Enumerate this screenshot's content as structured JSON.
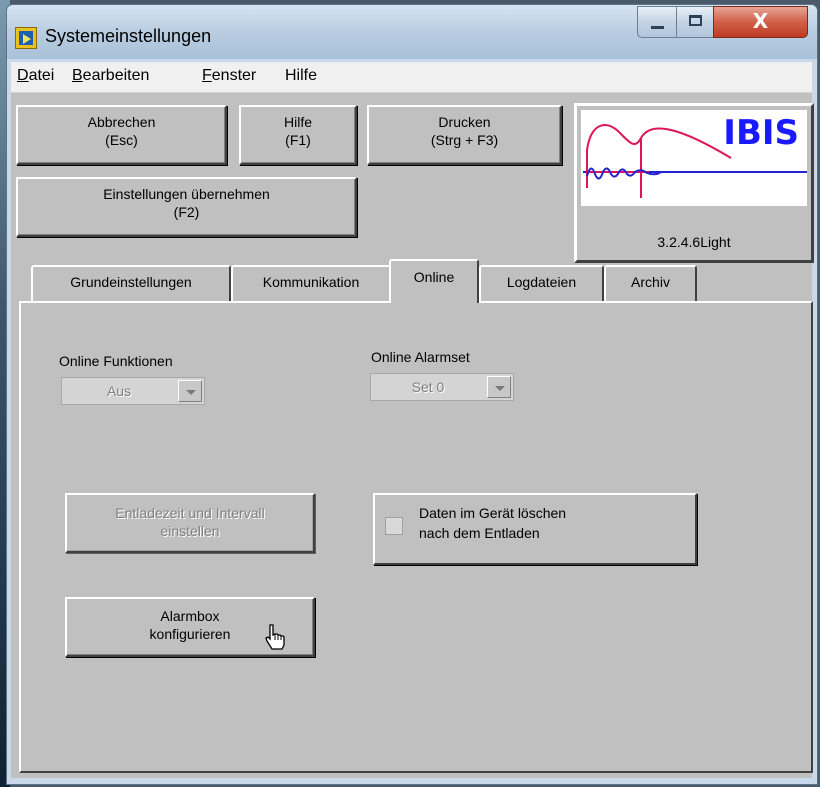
{
  "window": {
    "title": "Systemeinstellungen",
    "close_glyph": "X"
  },
  "menu": [
    {
      "underline": "D",
      "rest": "atei"
    },
    {
      "underline": "B",
      "rest": "earbeiten"
    },
    {
      "underline": "F",
      "rest": "enster"
    },
    {
      "underline": "",
      "rest": "Hilfe"
    }
  ],
  "toolbar": {
    "cancel": {
      "line1": "Abbrechen",
      "line2": "(Esc)"
    },
    "help": {
      "line1": "Hilfe",
      "line2": "(F1)"
    },
    "print": {
      "line1": "Drucken",
      "line2": "(Strg + F3)"
    },
    "apply": {
      "line1": "Einstellungen übernehmen",
      "line2": "(F2)"
    }
  },
  "logo": {
    "text": "IBIS",
    "version": "3.2.4.6Light",
    "accent": "#1a1aff",
    "curve_color": "#e0145a",
    "wave_color": "#2323d0"
  },
  "tabs": [
    "Grundeinstellungen",
    "Kommunikation",
    "Online",
    "Logdateien",
    "Archiv"
  ],
  "active_tab": "Online",
  "online": {
    "functions_label": "Online Funktionen",
    "functions_value": "Aus",
    "alarmset_label": "Online Alarmset",
    "alarmset_value": "Set 0",
    "discharge_button": {
      "line1": "Entladezeit und Intervall",
      "line2": "einstellen"
    },
    "delete_checkbox": {
      "line1": "Daten im Gerät löschen",
      "line2": "nach dem Entladen",
      "checked": false
    },
    "alarmbox_button": {
      "line1": "Alarmbox",
      "line2": "konfigurieren"
    }
  }
}
